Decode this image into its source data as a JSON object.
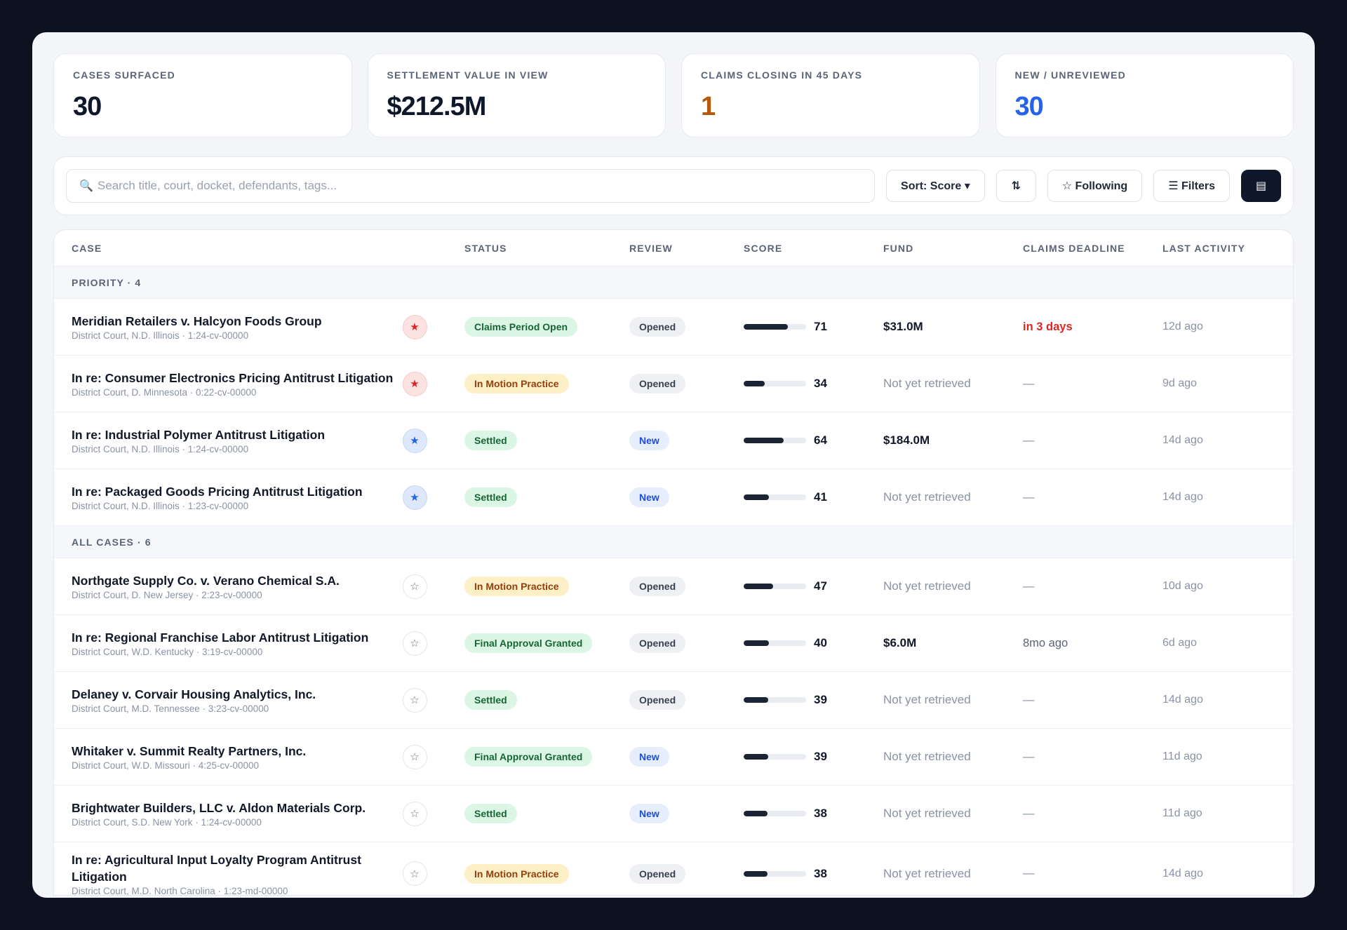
{
  "stats": [
    {
      "label": "CASES SURFACED",
      "value": "30",
      "tone": "default"
    },
    {
      "label": "SETTLEMENT VALUE IN VIEW",
      "value": "$212.5M",
      "tone": "default"
    },
    {
      "label": "CLAIMS CLOSING IN 45 DAYS",
      "value": "1",
      "tone": "amber"
    },
    {
      "label": "NEW / UNREVIEWED",
      "value": "30",
      "tone": "blue"
    }
  ],
  "toolbar": {
    "search_placeholder": "Search title, court, docket, defendants, tags...",
    "search_icon": "search-icon",
    "sort_label": "Sort: Score ▾",
    "sort_direction_icon": "⇅",
    "following_label": "☆ Following",
    "filters_label": "☰ Filters",
    "view_toggle_icon": "▤"
  },
  "table": {
    "headers": {
      "case": "CASE",
      "status": "STATUS",
      "review": "REVIEW",
      "score": "SCORE",
      "fund": "FUND",
      "deadline": "CLAIMS DEADLINE",
      "activity": "LAST ACTIVITY"
    },
    "groups": [
      {
        "label": "PRIORITY · 4",
        "rows": [
          {
            "title": "Meridian Retailers v. Halcyon Foods Group",
            "sub": "District Court, N.D. Illinois · 1:24-cv-00000",
            "star": "★",
            "star_tone": "red",
            "status": "Claims Period Open",
            "status_tone": "green",
            "review": "Opened",
            "review_tone": "gray",
            "score": 71,
            "score_label": "71",
            "fund": "$31.0M",
            "fund_tone": "bold",
            "deadline": "in 3 days",
            "deadline_tone": "red",
            "activity": "12d ago"
          },
          {
            "title": "In re: Consumer Electronics Pricing Antitrust Litigation",
            "sub": "District Court, D. Minnesota · 0:22-cv-00000",
            "star": "★",
            "star_tone": "red",
            "status": "In Motion Practice",
            "status_tone": "amber",
            "review": "Opened",
            "review_tone": "gray",
            "score": 34,
            "score_label": "34",
            "fund": "Not yet retrieved",
            "fund_tone": "muted",
            "deadline": "—",
            "deadline_tone": "muted",
            "activity": "9d ago"
          },
          {
            "title": "In re: Industrial Polymer Antitrust Litigation",
            "sub": "District Court, N.D. Illinois · 1:24-cv-00000",
            "star": "★",
            "star_tone": "blue",
            "status": "Settled",
            "status_tone": "green",
            "review": "New",
            "review_tone": "blue",
            "score": 64,
            "score_label": "64",
            "fund": "$184.0M",
            "fund_tone": "bold",
            "deadline": "—",
            "deadline_tone": "muted",
            "activity": "14d ago"
          },
          {
            "title": "In re: Packaged Goods Pricing Antitrust Litigation",
            "sub": "District Court, N.D. Illinois · 1:23-cv-00000",
            "star": "★",
            "star_tone": "blue",
            "status": "Settled",
            "status_tone": "green",
            "review": "New",
            "review_tone": "blue",
            "score": 41,
            "score_label": "41",
            "fund": "Not yet retrieved",
            "fund_tone": "muted",
            "deadline": "—",
            "deadline_tone": "muted",
            "activity": "14d ago"
          }
        ]
      },
      {
        "label": "ALL CASES · 6",
        "rows": [
          {
            "title": "Northgate Supply Co. v. Verano Chemical S.A.",
            "sub": "District Court, D. New Jersey · 2:23-cv-00000",
            "star": "☆",
            "star_tone": "none",
            "status": "In Motion Practice",
            "status_tone": "amber",
            "review": "Opened",
            "review_tone": "gray",
            "score": 47,
            "score_label": "47",
            "fund": "Not yet retrieved",
            "fund_tone": "muted",
            "deadline": "—",
            "deadline_tone": "muted",
            "activity": "10d ago"
          },
          {
            "title": "In re: Regional Franchise Labor Antitrust Litigation",
            "sub": "District Court, W.D. Kentucky · 3:19-cv-00000",
            "star": "☆",
            "star_tone": "none",
            "status": "Final Approval Granted",
            "status_tone": "green",
            "review": "Opened",
            "review_tone": "gray",
            "score": 40,
            "score_label": "40",
            "fund": "$6.0M",
            "fund_tone": "bold",
            "deadline": "8mo ago",
            "deadline_tone": "plain",
            "activity": "6d ago"
          },
          {
            "title": "Delaney v. Corvair Housing Analytics, Inc.",
            "sub": "District Court, M.D. Tennessee · 3:23-cv-00000",
            "star": "☆",
            "star_tone": "none",
            "status": "Settled",
            "status_tone": "green",
            "review": "Opened",
            "review_tone": "gray",
            "score": 39,
            "score_label": "39",
            "fund": "Not yet retrieved",
            "fund_tone": "muted",
            "deadline": "—",
            "deadline_tone": "muted",
            "activity": "14d ago"
          },
          {
            "title": "Whitaker v. Summit Realty Partners, Inc.",
            "sub": "District Court, W.D. Missouri · 4:25-cv-00000",
            "star": "☆",
            "star_tone": "none",
            "status": "Final Approval Granted",
            "status_tone": "green",
            "review": "New",
            "review_tone": "blue",
            "score": 39,
            "score_label": "39",
            "fund": "Not yet retrieved",
            "fund_tone": "muted",
            "deadline": "—",
            "deadline_tone": "muted",
            "activity": "11d ago"
          },
          {
            "title": "Brightwater Builders, LLC v. Aldon Materials Corp.",
            "sub": "District Court, S.D. New York · 1:24-cv-00000",
            "star": "☆",
            "star_tone": "none",
            "status": "Settled",
            "status_tone": "green",
            "review": "New",
            "review_tone": "blue",
            "score": 38,
            "score_label": "38",
            "fund": "Not yet retrieved",
            "fund_tone": "muted",
            "deadline": "—",
            "deadline_tone": "muted",
            "activity": "11d ago"
          },
          {
            "title": "In re: Agricultural Input Loyalty Program Antitrust Litigation",
            "sub": "District Court, M.D. North Carolina · 1:23-md-00000",
            "star": "☆",
            "star_tone": "none",
            "status": "In Motion Practice",
            "status_tone": "amber",
            "review": "Opened",
            "review_tone": "gray",
            "score": 38,
            "score_label": "38",
            "fund": "Not yet retrieved",
            "fund_tone": "muted",
            "deadline": "—",
            "deadline_tone": "muted",
            "activity": "14d ago"
          }
        ]
      }
    ]
  },
  "colors": {
    "background": "#0d1220",
    "accent_amber": "#b4570f",
    "accent_blue": "#2563eb",
    "danger": "#dc2626"
  }
}
